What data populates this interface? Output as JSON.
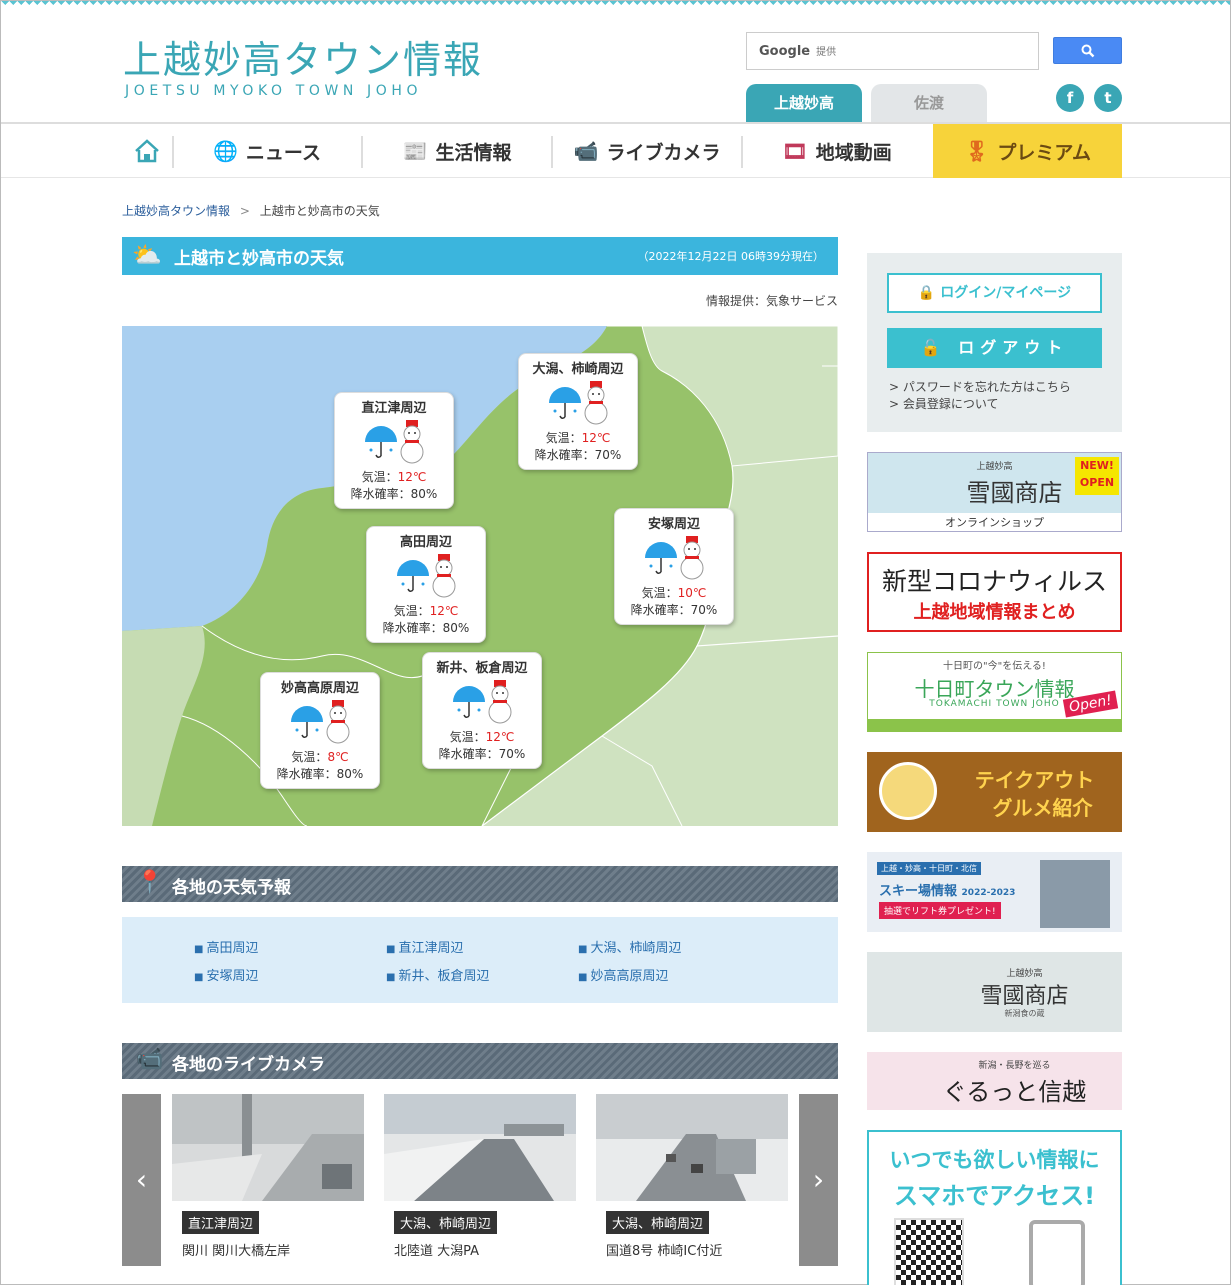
{
  "header": {
    "logo_jp": "上越妙高タウン情報",
    "logo_en": "JOETSU MYOKO TOWN JOHO",
    "search_brand": "Google",
    "search_sub": "提供",
    "search_icon": "search-icon",
    "tabs": [
      "上越妙高",
      "佐渡"
    ],
    "social": [
      "f",
      "t"
    ]
  },
  "nav": {
    "items": [
      "ニュース",
      "生活情報",
      "ライブカメラ",
      "地域動画",
      "プレミアム"
    ]
  },
  "breadcrumb": {
    "home": "上越妙高タウン情報",
    "sep": ">",
    "current": "上越市と妙高市の天気"
  },
  "weather": {
    "title": "上越市と妙高市の天気",
    "date": "（2022年12月22日 06時39分現在）",
    "credit": "情報提供：気象サービス",
    "cards": [
      {
        "name": "直江津周辺",
        "temp_label": "気温：",
        "temp": "12℃",
        "rain": "降水確率：80%"
      },
      {
        "name": "大潟、柿崎周辺",
        "temp_label": "気温：",
        "temp": "12℃",
        "rain": "降水確率：70%"
      },
      {
        "name": "高田周辺",
        "temp_label": "気温：",
        "temp": "12℃",
        "rain": "降水確率：80%"
      },
      {
        "name": "安塚周辺",
        "temp_label": "気温：",
        "temp": "10℃",
        "rain": "降水確率：70%"
      },
      {
        "name": "妙高高原周辺",
        "temp_label": "気温：",
        "temp": "8℃",
        "rain": "降水確率：80%"
      },
      {
        "name": "新井、板倉周辺",
        "temp_label": "気温：",
        "temp": "12℃",
        "rain": "降水確率：70%"
      }
    ]
  },
  "forecast": {
    "title": "各地の天気予報",
    "areas": [
      "高田周辺",
      "直江津周辺",
      "大潟、柿崎周辺",
      "安塚周辺",
      "新井、板倉周辺",
      "妙高高原周辺"
    ]
  },
  "cameras": {
    "title": "各地のライブカメラ",
    "prev": "‹",
    "next": "›",
    "items": [
      {
        "tag": "直江津周辺",
        "caption": "関川 関川大橋左岸"
      },
      {
        "tag": "大潟、柿崎周辺",
        "caption": "北陸道 大潟PA"
      },
      {
        "tag": "大潟、柿崎周辺",
        "caption": "国道8号 柿崎IC付近"
      }
    ]
  },
  "sidebar": {
    "login": "ログイン/マイページ",
    "logout": "ログアウト",
    "links": [
      "パスワードを忘れた方はこちら",
      "会員登録について"
    ],
    "banners": {
      "yuki_small": "上越妙高",
      "yuki_title": "雪國商店",
      "yuki_new": "NEW! OPEN",
      "yuki_sub": "オンラインショップ",
      "corona_1": "新型コロナウィルス",
      "corona_2": "上越地域情報まとめ",
      "tokamachi_top": "十日町の\"今\"を伝える!",
      "tokamachi_title": "十日町タウン情報",
      "tokamachi_en": "TOKAMACHI TOWN JOHO",
      "tokamachi_open": "Open!",
      "takeout_1": "テイクアウト",
      "takeout_2": "グルメ紹介",
      "ski_top": "上越・妙高・十日町・北信",
      "ski_title": "スキー場情報",
      "ski_year": "2022-2023",
      "ski_sub": "抽選でリフト券プレゼント!",
      "yuki2_small": "上越妙高",
      "yuki2_title": "雪國商店",
      "yuki2_sub": "新潟食の蔵",
      "shinetsu_top": "新潟・長野を巡る",
      "shinetsu_title": "ぐるっと信越",
      "app_1": "いつでも欲しい情報に",
      "app_2": "スマホでアクセス!"
    }
  },
  "colors": {
    "accent": "#3aa6b5",
    "weather_bar": "#3bb5dd",
    "premium": "#f7d33a"
  }
}
